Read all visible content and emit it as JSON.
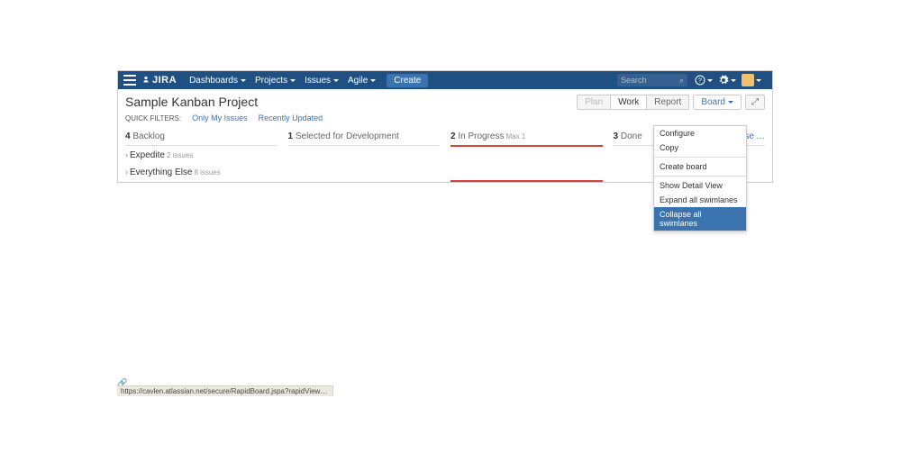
{
  "topbar": {
    "logo_text": "JIRA",
    "nav": {
      "dashboards": "Dashboards",
      "projects": "Projects",
      "issues": "Issues",
      "agile": "Agile"
    },
    "create_label": "Create",
    "search_placeholder": "Search"
  },
  "header": {
    "project_title": "Sample Kanban Project",
    "tabs": {
      "plan": "Plan",
      "work": "Work",
      "report": "Report"
    },
    "board_label": "Board",
    "fullscreen_glyph": "⤢"
  },
  "filters": {
    "label": "QUICK FILTERS:",
    "only_my": "Only My Issues",
    "recent": "Recently Updated"
  },
  "columns": {
    "backlog": {
      "count": "4",
      "label": "Backlog"
    },
    "selected": {
      "count": "1",
      "label": "Selected for Development"
    },
    "inprogress": {
      "count": "2",
      "label": "In Progress",
      "limit": "Max 1"
    },
    "done": {
      "count": "3",
      "label": "Done"
    },
    "release_label": "Release"
  },
  "swimlanes": {
    "expedite": {
      "label": "Expedite",
      "count": "2 issues"
    },
    "everything": {
      "label": "Everything Else",
      "count": "8 issues"
    }
  },
  "dropdown": {
    "configure": "Configure",
    "copy": "Copy",
    "create_board": "Create board",
    "show_detail": "Show Detail View",
    "expand": "Expand all swimlanes",
    "collapse": "Collapse all swimlanes"
  },
  "status_url": "https://cavlen.atlassian.net/secure/RapidBoard.jspa?rapidView=13&selectedIssue=SKP-8#"
}
